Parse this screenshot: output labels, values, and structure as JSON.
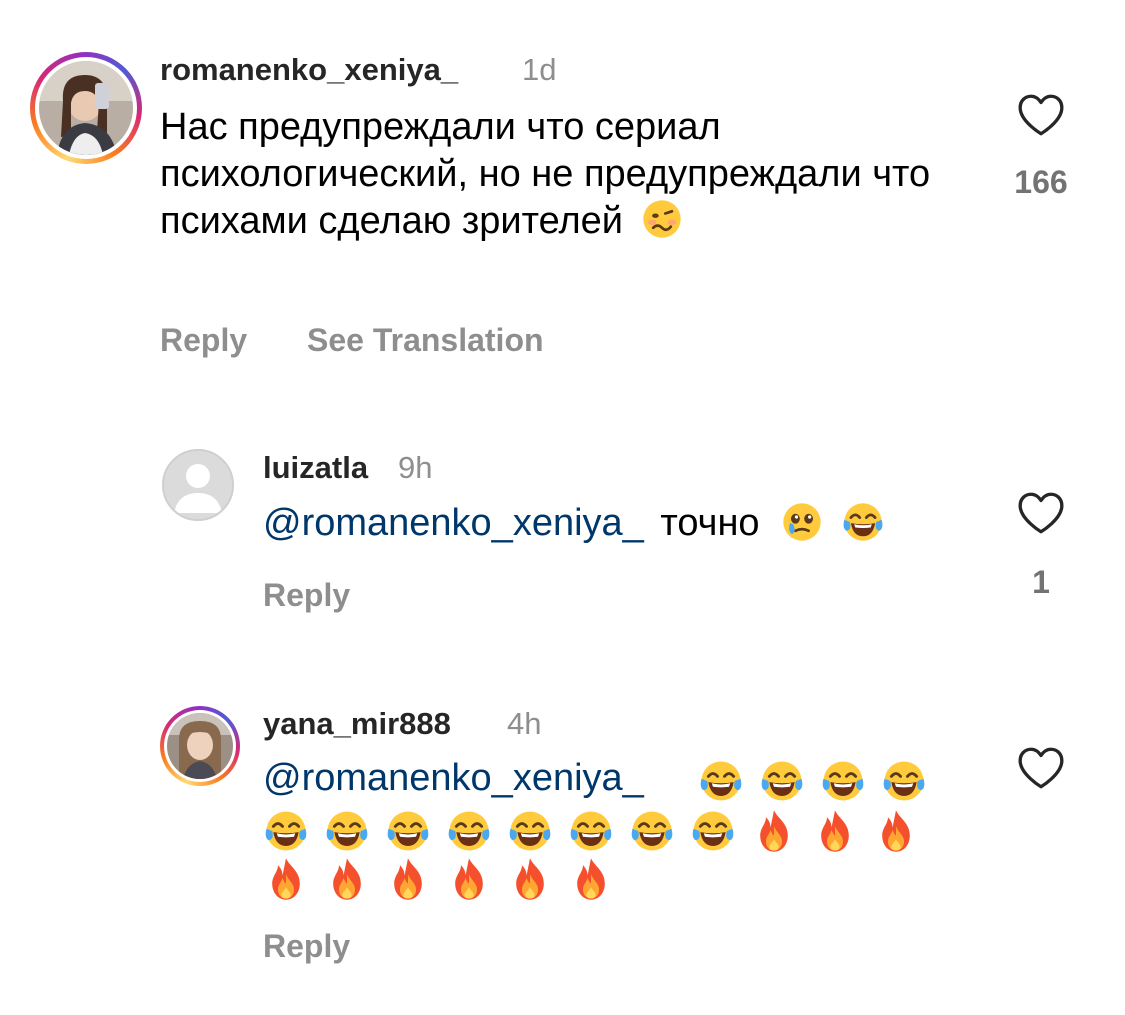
{
  "comments": [
    {
      "username": "romanenko_xeniya_",
      "time": "1d",
      "text": "Нас предупреждали что сериал психологический, но не предупреждали что психами сделаю зрителей",
      "emojis": [
        "woozy-face-emoji"
      ],
      "reply_label": "Reply",
      "translate_label": "See Translation",
      "likes": "166",
      "avatar": "user-photo-avatar"
    },
    {
      "username": "luizatla",
      "time": "9h",
      "mention": "@romanenko_xeniya_",
      "text": "точно",
      "emojis": [
        "holding-back-tears-emoji",
        "tears-of-joy-emoji"
      ],
      "reply_label": "Reply",
      "likes": "1",
      "avatar": "default-avatar"
    },
    {
      "username": "yana_mir888",
      "time": "4h",
      "mention": "@romanenko_xeniya_",
      "emojis": [
        "tears-of-joy-emoji x12",
        "fire-emoji x9"
      ],
      "reply_label": "Reply",
      "avatar": "user-photo-avatar"
    }
  ],
  "colors": {
    "mention": "#00376b",
    "secondary_text": "#8e8e8e",
    "username": "#262626",
    "heart_outline": "#262626"
  }
}
